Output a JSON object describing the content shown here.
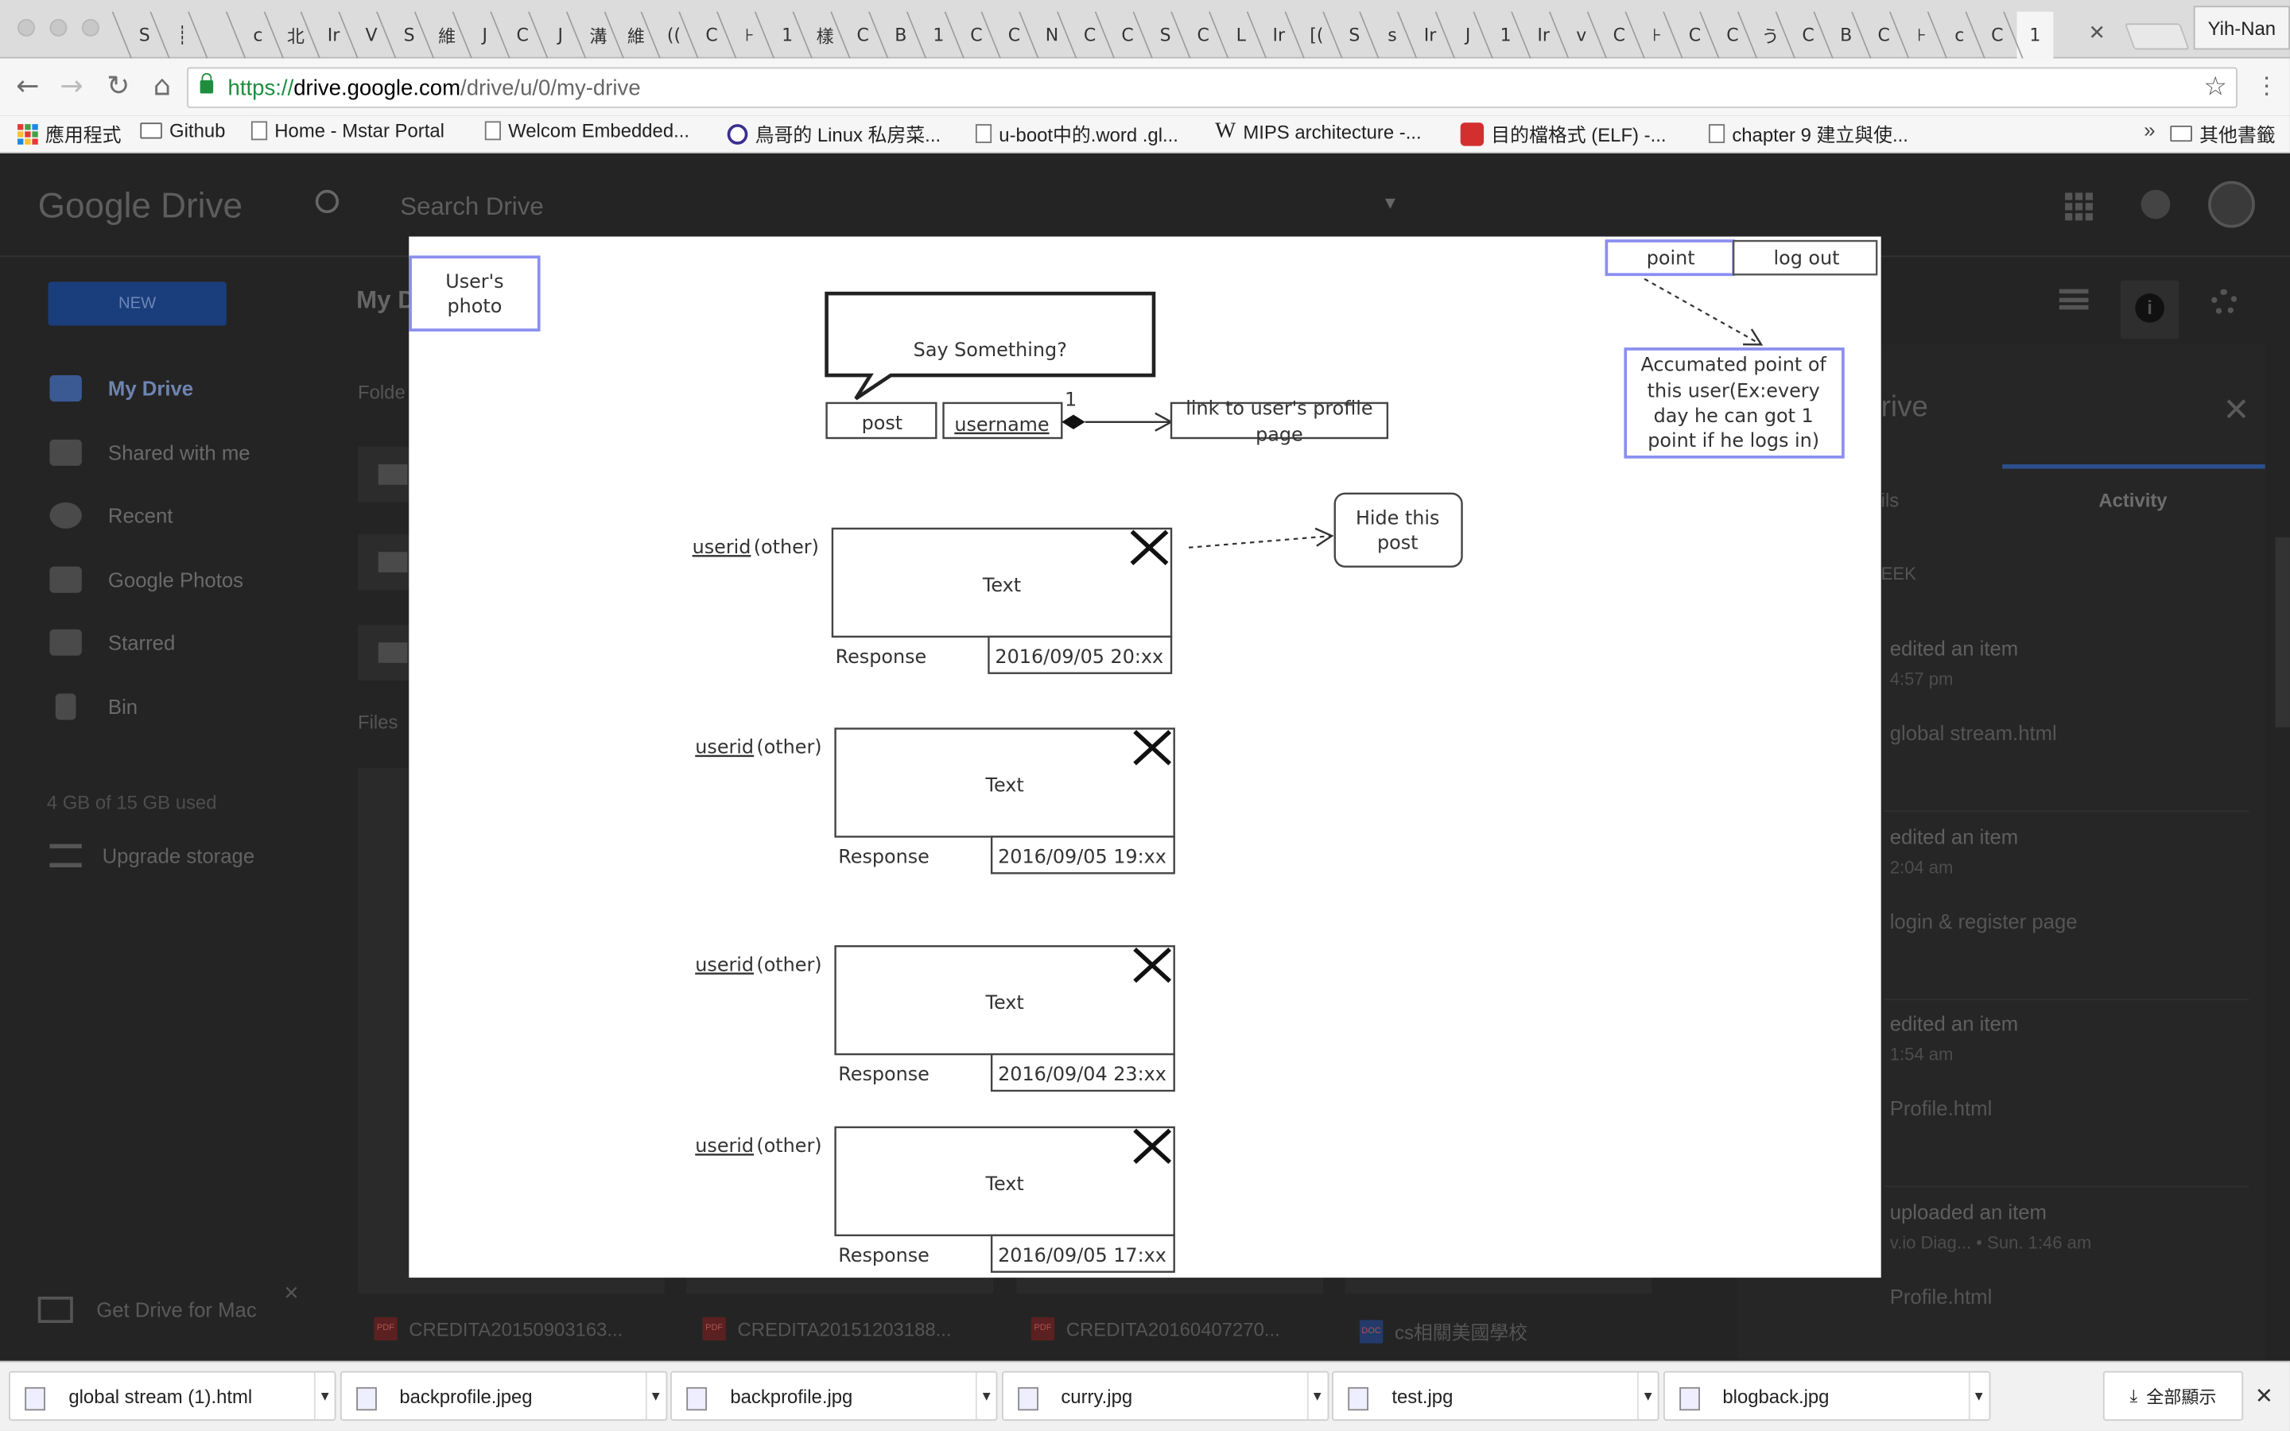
{
  "browser": {
    "tabs": [
      "S",
      "┊",
      "",
      "c",
      "北",
      "Ir",
      "V",
      "S",
      "維",
      "J",
      "C",
      "J",
      "溝",
      "維",
      "((",
      "C",
      "⊦",
      "1",
      "樣",
      "C",
      "B",
      "1",
      "C",
      "C",
      "Ν",
      "C",
      "C",
      "S",
      "C",
      "L",
      "Ir",
      "[(",
      "S",
      "s",
      "Ir",
      "J",
      "1",
      "Ir",
      "v",
      "C",
      "⊦",
      "C",
      "C",
      "う",
      "C",
      "B",
      "C",
      "⊦",
      "c",
      "C",
      "1"
    ],
    "profile_name": "Yih-Nan",
    "url_scheme": "https://",
    "url_host": "drive.google.com",
    "url_path": "/drive/u/0/my-drive",
    "bookmarks": [
      {
        "label": "應用程式",
        "icon": "apps-icon"
      },
      {
        "label": "Github",
        "icon": "folder-icon"
      },
      {
        "label": "Home - Mstar Portal",
        "icon": "page-icon"
      },
      {
        "label": "Welcom Embedded...",
        "icon": "page-icon"
      },
      {
        "label": "鳥哥的 Linux 私房菜...",
        "icon": "bird-icon"
      },
      {
        "label": "u-boot中的.word .gl...",
        "icon": "page-icon"
      },
      {
        "label": "MIPS architecture -...",
        "icon": "wikipedia-icon"
      },
      {
        "label": "目的檔格式 (ELF) -...",
        "icon": "red-app-icon"
      },
      {
        "label": "chapter 9 建立與使...",
        "icon": "page-icon"
      }
    ],
    "other_bookmarks": "其他書籤"
  },
  "drive": {
    "logo_google": "Google",
    "logo_drive": "Drive",
    "search_placeholder": "Search Drive",
    "new_label": "NEW",
    "title": "My D",
    "nav": [
      {
        "label": "My Drive",
        "active": true
      },
      {
        "label": "Shared with me",
        "active": false
      },
      {
        "label": "Recent",
        "active": false
      },
      {
        "label": "Google Photos",
        "active": false
      },
      {
        "label": "Starred",
        "active": false
      },
      {
        "label": "Bin",
        "active": false
      }
    ],
    "storage": "4 GB of 15 GB used",
    "upgrade": "Upgrade storage",
    "get_drive": "Get Drive for Mac",
    "folders_label": "Folde",
    "files_label": "Files",
    "files": [
      {
        "name": "CREDITA20150903163...",
        "type": "PDF"
      },
      {
        "name": "CREDITA20151203188...",
        "type": "PDF"
      },
      {
        "name": "CREDITA20160407270...",
        "type": "PDF"
      },
      {
        "name": "cs相關美國學校",
        "type": "DOC"
      }
    ],
    "panel": {
      "title": "rive",
      "tab_details": "ils",
      "tab_activity": "Activity",
      "week": "EEK",
      "activities": [
        {
          "action": "edited an item",
          "time": "4:57 pm",
          "item": "global stream.html"
        },
        {
          "action": "edited an item",
          "time": "2:04 am",
          "item": "login & register page"
        },
        {
          "action": "edited an item",
          "time": "1:54 am",
          "item": "Profile.html"
        },
        {
          "action": "uploaded an item",
          "time": "v.io Diag... • Sun. 1:46 am",
          "item": "Profile.html"
        }
      ]
    }
  },
  "diagram": {
    "user_photo": [
      "User's",
      "photo"
    ],
    "point": "point",
    "logout": "log out",
    "bubble": "Say Something?",
    "post": "post",
    "username": "username",
    "multiplicity": "1",
    "profile_link": [
      "link to user's profile",
      "page"
    ],
    "point_note": [
      "Accumated point of",
      "this user(Ex:every",
      "day he can got 1",
      "point if he logs in)"
    ],
    "hide_post": [
      "Hide this",
      "post"
    ],
    "posts": [
      {
        "userid": "userid",
        "other": "(other)",
        "text": "Text",
        "response": "Response",
        "time": "2016/09/05 20:xx"
      },
      {
        "userid": "userid",
        "other": "(other)",
        "text": "Text",
        "response": "Response",
        "time": "2016/09/05 19:xx"
      },
      {
        "userid": "userid",
        "other": "(other)",
        "text": "Text",
        "response": "Response",
        "time": "2016/09/04 23:xx"
      },
      {
        "userid": "userid",
        "other": "(other)",
        "text": "Text",
        "response": "Response",
        "time": "2016/09/05 17:xx"
      }
    ]
  },
  "downloads": {
    "items": [
      "global stream (1).html",
      "backprofile.jpeg",
      "backprofile.jpg",
      "curry.jpg",
      "test.jpg",
      "blogback.jpg"
    ],
    "show_all": "全部顯示"
  }
}
